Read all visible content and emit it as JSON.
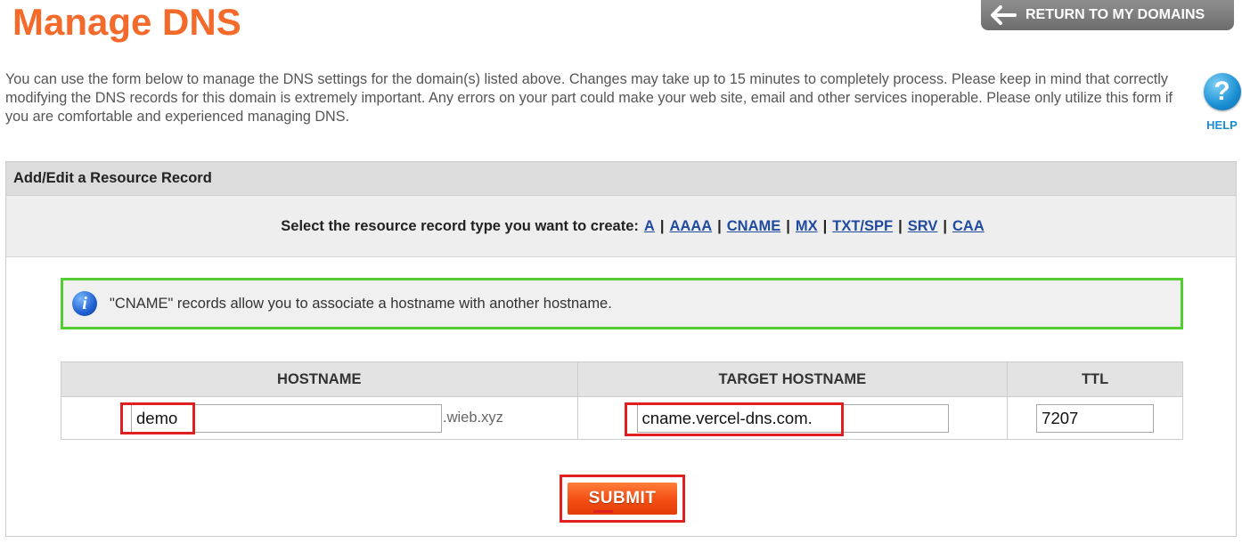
{
  "header": {
    "title": "Manage DNS",
    "return_label": "RETURN TO MY DOMAINS",
    "return_icon": "arrow-left-icon"
  },
  "intro_text": "You can use the form below to manage the DNS settings for the domain(s) listed above. Changes may take up to 15 minutes to completely process. Please keep in mind that correctly modifying the DNS records for this domain is extremely important. Any errors on your part could make your web site, email and other services inoperable. Please only utilize this form if you are comfortable and experienced managing DNS.",
  "help": {
    "symbol": "?",
    "label": "HELP",
    "icon": "help-icon"
  },
  "panel": {
    "title": "Add/Edit a Resource Record",
    "type_prompt": "Select the resource record type you want to create:",
    "record_types": [
      "A",
      "AAAA",
      "CNAME",
      "MX",
      "TXT/SPF",
      "SRV",
      "CAA"
    ],
    "separator": "|"
  },
  "info": {
    "icon": "info-icon",
    "symbol": "i",
    "text": "\"CNAME\" records allow you to associate a hostname with another hostname."
  },
  "table": {
    "headers": [
      "HOSTNAME",
      "TARGET HOSTNAME",
      "TTL"
    ],
    "hostname_value": "demo",
    "domain_suffix": ".wieb.xyz",
    "target_value": "cname.vercel-dns.com.",
    "ttl_value": "7207"
  },
  "submit_label": "SUBMIT",
  "colors": {
    "title": "#f36a2b",
    "link": "#1f4a9e",
    "info_border": "#55cc33",
    "highlight": "#e02020",
    "submit": "#f34e12"
  }
}
